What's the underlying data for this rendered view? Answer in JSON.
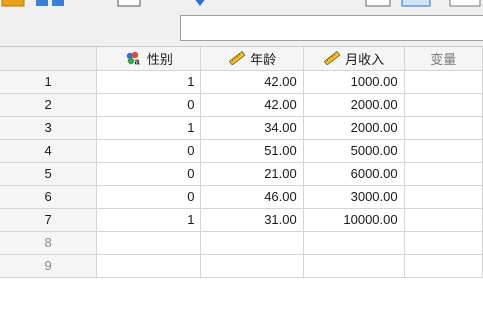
{
  "columns": [
    {
      "label": "性别",
      "icon": "nominal-variable-icon"
    },
    {
      "label": "年龄",
      "icon": "scale-variable-ruler-icon"
    },
    {
      "label": "月收入",
      "icon": "scale-variable-ruler-icon"
    },
    {
      "label": "变量",
      "icon": ""
    }
  ],
  "rows": [
    {
      "num": "1",
      "cells": [
        "1",
        "42.00",
        "1000.00",
        ""
      ]
    },
    {
      "num": "2",
      "cells": [
        "0",
        "42.00",
        "2000.00",
        ""
      ]
    },
    {
      "num": "3",
      "cells": [
        "1",
        "34.00",
        "2000.00",
        ""
      ]
    },
    {
      "num": "4",
      "cells": [
        "0",
        "51.00",
        "5000.00",
        ""
      ]
    },
    {
      "num": "5",
      "cells": [
        "0",
        "21.00",
        "6000.00",
        ""
      ]
    },
    {
      "num": "6",
      "cells": [
        "0",
        "46.00",
        "3000.00",
        ""
      ]
    },
    {
      "num": "7",
      "cells": [
        "1",
        "31.00",
        "10000.00",
        ""
      ]
    },
    {
      "num": "8",
      "cells": [
        "",
        "",
        "",
        ""
      ]
    },
    {
      "num": "9",
      "cells": [
        "",
        "",
        "",
        ""
      ]
    }
  ],
  "colors": {
    "header_bg": "#f5f5f5",
    "grid_line": "#d4d4d4",
    "inactive_text": "#8a8a8a",
    "ruler_yellow": "#f2c230"
  }
}
